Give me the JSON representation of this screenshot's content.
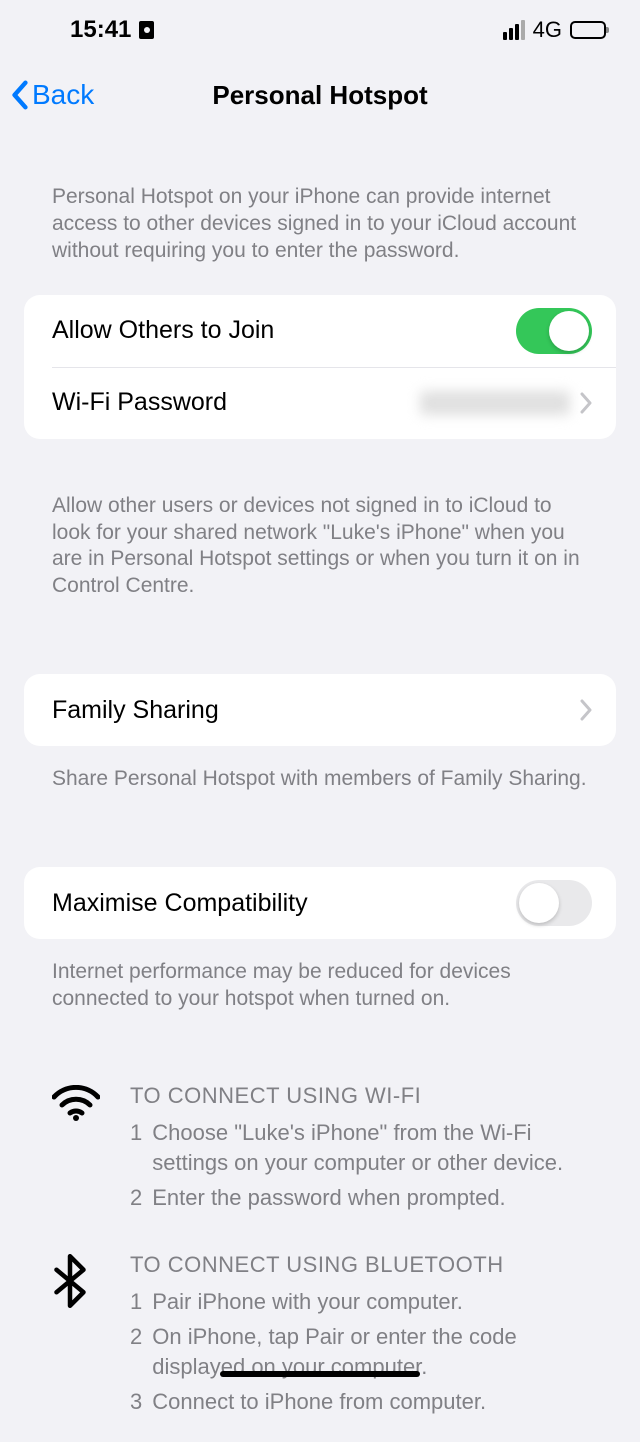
{
  "status": {
    "time": "15:41",
    "network": "4G"
  },
  "nav": {
    "back": "Back",
    "title": "Personal Hotspot"
  },
  "intro": "Personal Hotspot on your iPhone can provide internet access to other devices signed in to your iCloud account without requiring you to enter the password.",
  "allow": {
    "label": "Allow Others to Join",
    "on": true
  },
  "wifi_password": {
    "label": "Wi-Fi Password"
  },
  "allow_footer": "Allow other users or devices not signed in to iCloud to look for your shared network \"Luke's iPhone\" when you are in Personal Hotspot settings or when you turn it on in Control Centre.",
  "family": {
    "label": "Family Sharing",
    "footer": "Share Personal Hotspot with members of Family Sharing."
  },
  "compat": {
    "label": "Maximise Compatibility",
    "on": false,
    "footer": "Internet performance may be reduced for devices connected to your hotspot when turned on."
  },
  "connect": {
    "wifi": {
      "heading": "TO CONNECT USING WI-FI",
      "steps": [
        "Choose \"Luke's iPhone\" from the Wi-Fi settings on your computer or other device.",
        "Enter the password when prompted."
      ]
    },
    "bluetooth": {
      "heading": "TO CONNECT USING BLUETOOTH",
      "steps": [
        "Pair iPhone with your computer.",
        "On iPhone, tap Pair or enter the code displayed on your computer.",
        "Connect to iPhone from computer."
      ]
    }
  }
}
